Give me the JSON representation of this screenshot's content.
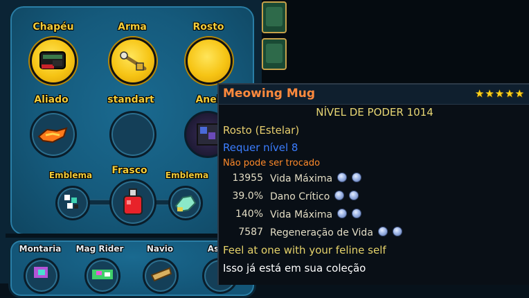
{
  "equipment": {
    "slots": {
      "hat": "Chapéu",
      "weapon": "Arma",
      "face": "Rosto",
      "ally": "Aliado",
      "costume": "standart",
      "ring": "Anel",
      "emblem_left": "Emblema",
      "flask": "Frasco",
      "emblem_right": "Emblema"
    },
    "bottom_slots": {
      "mount": "Montaria",
      "mag_rider": "Mag Rider",
      "ship": "Navio",
      "partial": "As"
    }
  },
  "tooltip": {
    "name": "Meowing Mug",
    "stars": "★★★★★",
    "power_level": "NÍVEL DE PODER 1014",
    "slot_type": "Rosto (Estelar)",
    "requirement": "Requer nível 8",
    "trade_status": "Não pode ser trocado",
    "stats": [
      {
        "value": "13955",
        "name": "Vida Máxima"
      },
      {
        "value": "39.0%",
        "name": "Dano Crítico"
      },
      {
        "value": "140%",
        "name": "Vida Máxima"
      },
      {
        "value": "7587",
        "name": "Regeneração de Vida"
      }
    ],
    "flavor_text": "Feel at one with your feline self",
    "collection_text": "Isso já está em sua coleção"
  },
  "colors": {
    "item_name": "#ff8a3d",
    "stars": "#ffd21a",
    "requirement": "#3b7dff",
    "trade": "#ff8a2a",
    "flavor": "#e6d36a",
    "slot_label": "#f2cc3a"
  }
}
